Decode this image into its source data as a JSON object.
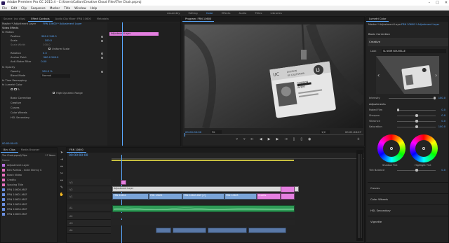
{
  "window": {
    "title": "Adobe Premiere Pro CC 2015.4 - C:\\Users\\Callan\\Creative Cloud Files\\The Chair.prproj"
  },
  "menu": [
    "File",
    "Edit",
    "Clip",
    "Sequence",
    "Marker",
    "Title",
    "Window",
    "Help"
  ],
  "workspaces": [
    "Assembly",
    "Editing",
    "Color",
    "Effects",
    "Audio",
    "Titles",
    "Libraries"
  ],
  "active_workspace": "Color",
  "source_tabs": [
    "Source: (no clips)",
    "Effect Controls",
    "Audio Clip Mixer: FRN 10600",
    "Metadata"
  ],
  "effect_controls": {
    "master": "Master * Adjustment Layer",
    "sequence": "FRN 10600 * Adjustment Layer",
    "clip_label": "Adjustment Layer",
    "section": "Video Effects",
    "rows": [
      {
        "label": "fx  Motion",
        "value": ""
      },
      {
        "label": "Position",
        "value": "960.0   540.0"
      },
      {
        "label": "Scale",
        "value": "100.0"
      },
      {
        "label": "Scale Width",
        "value": "100.0"
      },
      {
        "label": "Uniform Scale",
        "value": ""
      },
      {
        "label": "Rotation",
        "value": "0.0"
      },
      {
        "label": "Anchor Point",
        "value": "960.0   540.0"
      },
      {
        "label": "Anti-flicker Filter",
        "value": "0.00"
      },
      {
        "label": "fx  Opacity",
        "value": ""
      },
      {
        "label": "Opacity",
        "value": "100.0 %"
      },
      {
        "label": "Blend Mode",
        "value": "Normal"
      },
      {
        "label": "fx  Time Remapping",
        "value": ""
      },
      {
        "label": "fx  Lumetri Color",
        "value": ""
      },
      {
        "label": "High Dynamic Range",
        "value": ""
      },
      {
        "label": "Basic Correction",
        "value": ""
      },
      {
        "label": "Creative",
        "value": ""
      },
      {
        "label": "Curves",
        "value": ""
      },
      {
        "label": "Color Wheels",
        "value": ""
      },
      {
        "label": "HSL Secondary",
        "value": ""
      }
    ],
    "timecode": "00:00:00:00"
  },
  "program": {
    "tab": "Program: FRN 10600",
    "timecode_current": "00:00:00:00",
    "fit": "Fit",
    "quality": "1/2",
    "timecode_duration": "00:01:08:07",
    "badge_line1": "DIVISION",
    "badge_line2": "OF CALIFORNIA",
    "badge_name1": "DAWSON",
    "badge_name2": "AVERY"
  },
  "lumetri": {
    "tab": "Lumetri Color",
    "master": "Master * Adjustment Layer",
    "sequence": "FRN 10600 * Adjustment Layer",
    "basic_correction": "Basic Correction",
    "creative": "Creative",
    "look_label": "Look",
    "look_value": "SL NOIR NOUVELLE",
    "intensity_label": "Intensity",
    "intensity_value": "100.0",
    "adjustments": "Adjustments",
    "sliders": [
      {
        "label": "Faded Film",
        "value": "0.0",
        "pos": 0.0
      },
      {
        "label": "Sharpen",
        "value": "0.0",
        "pos": 0.5
      },
      {
        "label": "Vibrance",
        "value": "0.0",
        "pos": 0.5
      },
      {
        "label": "Saturation",
        "value": "100.0",
        "pos": 0.5
      }
    ],
    "shadow_tint": "Shadow Tint",
    "highlight_tint": "Highlight Tint",
    "tint_balance_label": "Tint Balance",
    "tint_balance_value": "0.0",
    "sections": [
      "Curves",
      "Color Wheels",
      "HSL Secondary",
      "Vignette"
    ]
  },
  "project": {
    "tabs": [
      "Bin: Clips",
      "Media Browser"
    ],
    "path": "The Chair.prproj\\Clips",
    "count": "17 Items",
    "items": [
      {
        "name": "Name",
        "color": ""
      },
      {
        "name": "Adjustment Layer",
        "color": "#b86fe0"
      },
      {
        "name": "Ben Ramos - Indie Skinny C",
        "color": "#e76fbf"
      },
      {
        "name": "Black Video",
        "color": "#e76fbf"
      },
      {
        "name": "Credits",
        "color": "#e76fbf"
      },
      {
        "name": "Spacing Title",
        "color": "#e76fbf"
      },
      {
        "name": "FRN 10600.MXF",
        "color": "#6a8fe0"
      },
      {
        "name": "FRN 10601.MXF",
        "color": "#6a8fe0"
      },
      {
        "name": "FRN 10602.MXF",
        "color": "#6a8fe0"
      },
      {
        "name": "FRN 10603.MXF",
        "color": "#6a8fe0"
      },
      {
        "name": "FRN 10604.MXF",
        "color": "#6a8fe0"
      },
      {
        "name": "FRN 10605.MXF",
        "color": "#6a8fe0"
      }
    ]
  },
  "timeline": {
    "tab": "FRN 10600",
    "timecode": "00:00:00:00",
    "tracks": [
      "V3",
      "V2",
      "V1",
      "A1",
      "A2",
      "A3",
      "A4"
    ],
    "adjustment_clip": "Adjustment Layer",
    "video_clips": [
      "FRN 10604",
      "FRN 10601",
      "FRN 10600.MXF [V]",
      "FRN 10603",
      "Credits"
    ]
  },
  "colors": {
    "accent": "#5aa9ff",
    "pink_clip": "#e47fe0",
    "video_clip": "#7aa4d8",
    "audio_clip": "#2e9a56"
  }
}
